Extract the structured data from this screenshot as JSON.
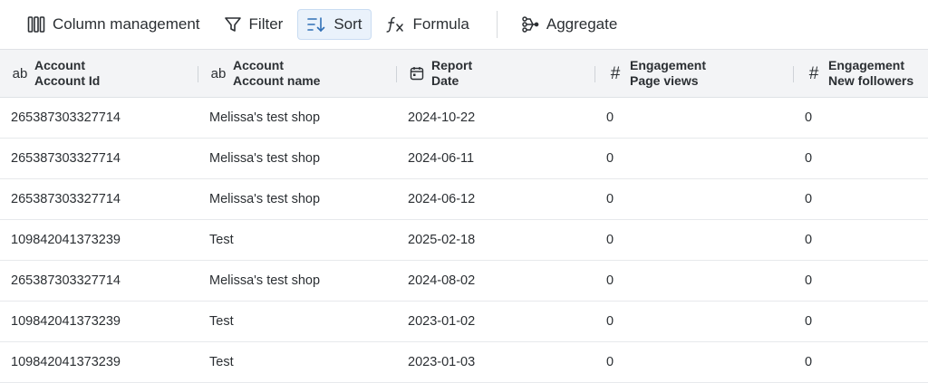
{
  "toolbar": {
    "column_management": {
      "label": "Column management",
      "icon": "columns-icon"
    },
    "filter": {
      "label": "Filter",
      "icon": "filter-icon"
    },
    "sort": {
      "label": "Sort",
      "icon": "sort-icon",
      "active": true
    },
    "formula": {
      "label": "Formula",
      "icon": "formula-icon"
    },
    "aggregate": {
      "label": "Aggregate",
      "icon": "aggregate-icon"
    }
  },
  "columns": [
    {
      "type_label": "ab",
      "line1": "Account",
      "line2": "Account Id"
    },
    {
      "type_label": "ab",
      "line1": "Account",
      "line2": "Account name"
    },
    {
      "type_label": "",
      "type_icon": "calendar-icon",
      "line1": "Report",
      "line2": "Date"
    },
    {
      "type_label": "#",
      "line1": "Engagement",
      "line2": "Page views"
    },
    {
      "type_label": "#",
      "line1": "Engagement",
      "line2": "New followers"
    }
  ],
  "rows": [
    [
      "265387303327714",
      "Melissa's test shop",
      "2024-10-22",
      "0",
      "0"
    ],
    [
      "265387303327714",
      "Melissa's test shop",
      "2024-06-11",
      "0",
      "0"
    ],
    [
      "265387303327714",
      "Melissa's test shop",
      "2024-06-12",
      "0",
      "0"
    ],
    [
      "109842041373239",
      "Test",
      "2025-02-18",
      "0",
      "0"
    ],
    [
      "265387303327714",
      "Melissa's test shop",
      "2024-08-02",
      "0",
      "0"
    ],
    [
      "109842041373239",
      "Test",
      "2023-01-02",
      "0",
      "0"
    ],
    [
      "109842041373239",
      "Test",
      "2023-01-03",
      "0",
      "0"
    ]
  ],
  "colors": {
    "accent": "#2f6fb6",
    "header_bg": "#f3f4f6",
    "active_bg": "#eaf2fb"
  }
}
